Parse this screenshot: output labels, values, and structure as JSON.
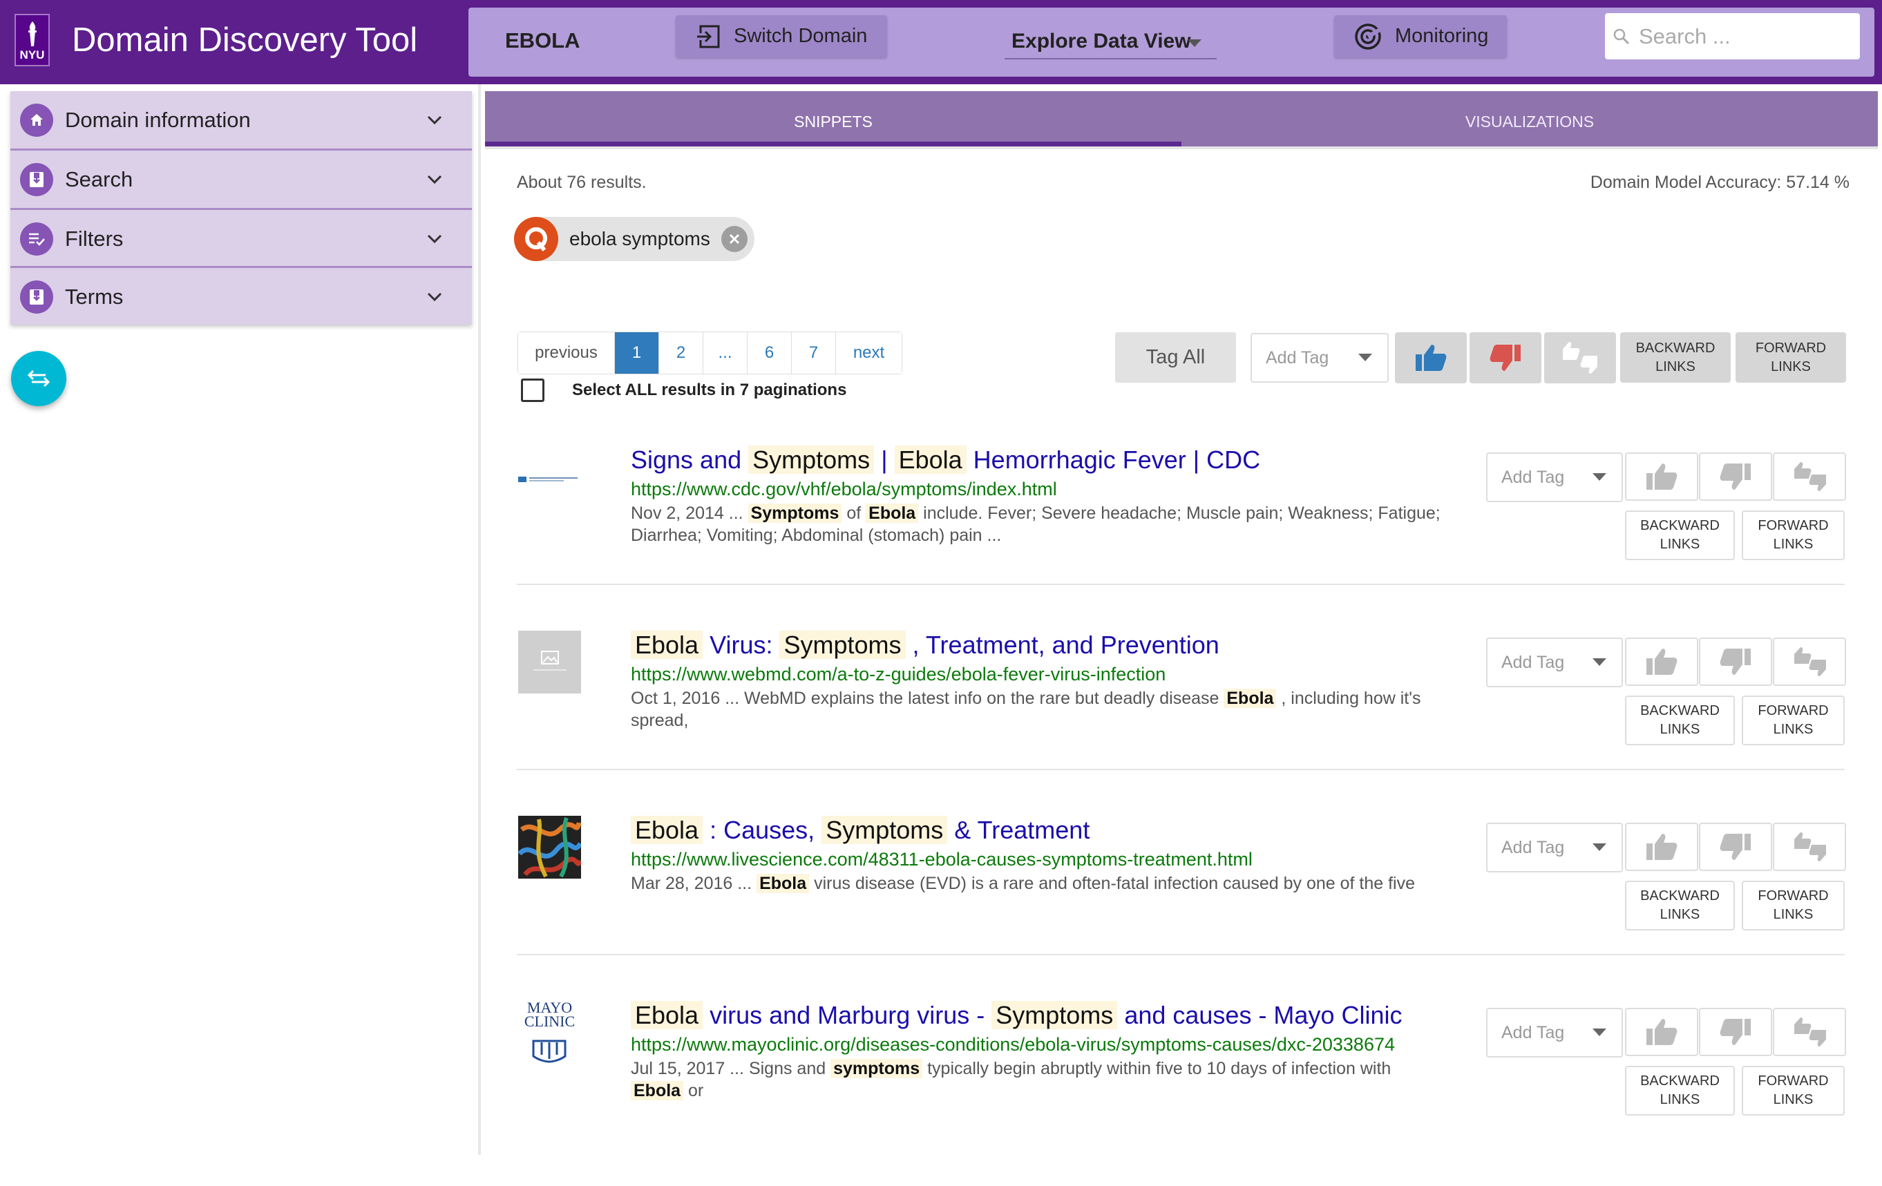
{
  "app": {
    "logo_text": "NYU",
    "title": "Domain Discovery Tool"
  },
  "header": {
    "domain_name": "EBOLA",
    "switch_label": "Switch Domain",
    "explore_label": "Explore Data View",
    "monitoring_label": "Monitoring",
    "search_placeholder": "Search ..."
  },
  "sidebar": {
    "items": [
      {
        "label": "Domain information",
        "icon": "home-icon"
      },
      {
        "label": "Search",
        "icon": "save-icon"
      },
      {
        "label": "Filters",
        "icon": "filter-list-icon"
      },
      {
        "label": "Terms",
        "icon": "save-icon"
      }
    ]
  },
  "tabs": [
    {
      "label": "SNIPPETS",
      "active": true
    },
    {
      "label": "VISUALIZATIONS",
      "active": false
    }
  ],
  "results_info": {
    "count_text": "About 76 results.",
    "accuracy_text": "Domain Model Accuracy: 57.14 %"
  },
  "query_chip": {
    "avatar": "Q",
    "label": "ebola symptoms"
  },
  "pagination": {
    "previous": "previous",
    "pages": [
      "1",
      "2",
      "...",
      "6",
      "7"
    ],
    "next": "next",
    "current": "1",
    "select_all": "Select ALL results in 7 paginations"
  },
  "bulk_actions": {
    "tag_all": "Tag All",
    "add_tag": "Add Tag",
    "backward_links": [
      "BACKWARD",
      "LINKS"
    ],
    "forward_links": [
      "FORWARD",
      "LINKS"
    ]
  },
  "results": [
    {
      "title": [
        {
          "t": "Signs and",
          "h": false
        },
        {
          "t": "Symptoms",
          "h": true
        },
        {
          "t": "|",
          "h": false
        },
        {
          "t": "Ebola",
          "h": true
        },
        {
          "t": "Hemorrhagic Fever | CDC",
          "h": false
        }
      ],
      "url": "https://www.cdc.gov/vhf/ebola/symptoms/index.html",
      "snippet": [
        {
          "t": "Nov 2, 2014 ...",
          "h": false
        },
        {
          "t": "Symptoms",
          "h": true
        },
        {
          "t": "of",
          "h": false
        },
        {
          "t": "Ebola",
          "h": true
        },
        {
          "t": "include. Fever; Severe headache; Muscle pain; Weakness; Fatigue; Diarrhea; Vomiting; Abdominal (stomach) pain ...",
          "h": false
        }
      ],
      "thumb": "cdc"
    },
    {
      "title": [
        {
          "t": "Ebola",
          "h": true
        },
        {
          "t": "Virus:",
          "h": false
        },
        {
          "t": "Symptoms",
          "h": true
        },
        {
          "t": ", Treatment, and Prevention",
          "h": false
        }
      ],
      "url": "https://www.webmd.com/a-to-z-guides/ebola-fever-virus-infection",
      "snippet": [
        {
          "t": "Oct 1, 2016 ... WebMD explains the latest info on the rare but deadly disease",
          "h": false
        },
        {
          "t": "Ebola",
          "h": true
        },
        {
          "t": ", including how it's spread,",
          "h": false
        }
      ],
      "thumb": "placeholder"
    },
    {
      "title": [
        {
          "t": "Ebola",
          "h": true
        },
        {
          "t": ": Causes,",
          "h": false
        },
        {
          "t": "Symptoms",
          "h": true
        },
        {
          "t": "& Treatment",
          "h": false
        }
      ],
      "url": "https://www.livescience.com/48311-ebola-causes-symptoms-treatment.html",
      "snippet": [
        {
          "t": "Mar 28, 2016 ...",
          "h": false
        },
        {
          "t": "Ebola",
          "h": true
        },
        {
          "t": "virus disease (EVD) is a rare and often-fatal infection caused by one of the five",
          "h": false
        }
      ],
      "thumb": "virus"
    },
    {
      "title": [
        {
          "t": "Ebola",
          "h": true
        },
        {
          "t": "virus and Marburg virus -",
          "h": false
        },
        {
          "t": "Symptoms",
          "h": true
        },
        {
          "t": "and causes - Mayo Clinic",
          "h": false
        }
      ],
      "url": "https://www.mayoclinic.org/diseases-conditions/ebola-virus/symptoms-causes/dxc-20338674",
      "snippet": [
        {
          "t": "Jul 15, 2017 ... Signs and",
          "h": false
        },
        {
          "t": "symptoms",
          "h": true
        },
        {
          "t": "typically begin abruptly within five to 10 days of infection with",
          "h": false
        },
        {
          "t": "Ebola",
          "h": true
        },
        {
          "t": "or",
          "h": false
        }
      ],
      "thumb": "mayo",
      "thumb_text": [
        "MAYO",
        "CLINIC"
      ]
    }
  ]
}
